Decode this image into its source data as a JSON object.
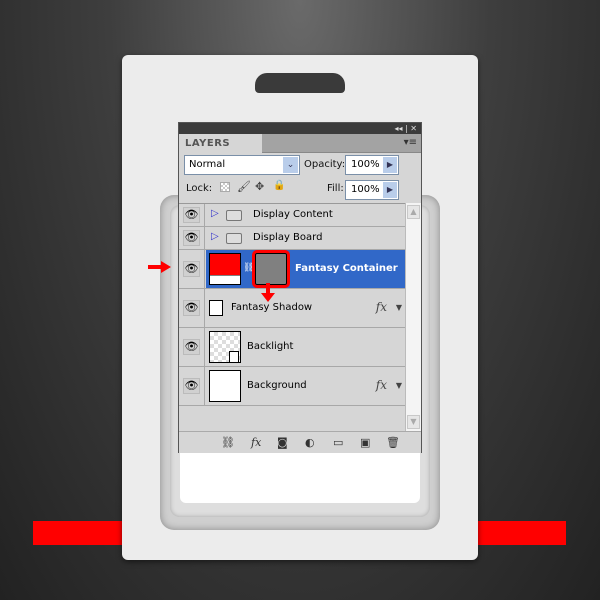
{
  "panel": {
    "title_controls": {
      "collapse": "◂◂",
      "close": "✕"
    },
    "tab": "LAYERS",
    "blend_mode": "Normal",
    "opacity_label": "Opacity:",
    "opacity": "100%",
    "lock_label": "Lock:",
    "fill_label": "Fill:",
    "fill": "100%",
    "layers": [
      {
        "name": "Display Content",
        "type": "group",
        "visible": true
      },
      {
        "name": "Display Board",
        "type": "group",
        "visible": true
      },
      {
        "name": "Fantasy Container",
        "type": "shape-with-mask",
        "visible": true,
        "selected": true
      },
      {
        "name": "Fantasy Shadow",
        "type": "smart-object",
        "visible": true,
        "fx": "fx"
      },
      {
        "name": "Backlight",
        "type": "smart-object",
        "visible": true
      },
      {
        "name": "Background",
        "type": "layer",
        "visible": true,
        "fx": "fx"
      }
    ],
    "bottom_icons": [
      "link-icon",
      "fx-icon",
      "mask-icon",
      "adjustment-icon",
      "folder-icon",
      "new-layer-icon",
      "trash-icon"
    ]
  },
  "colors": {
    "selection": "#3168c8",
    "highlight_red": "#ff0000"
  }
}
